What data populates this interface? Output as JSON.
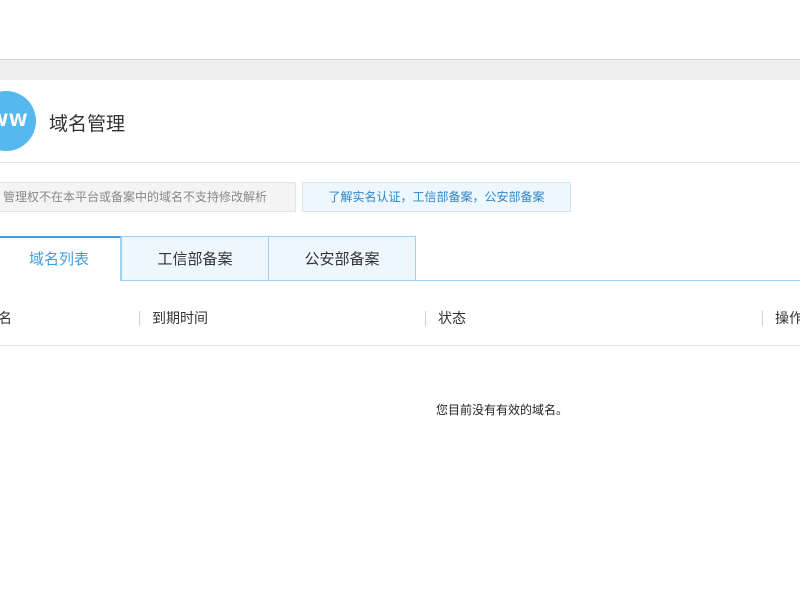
{
  "header": {
    "logo_text": "WW",
    "title": "域名管理"
  },
  "notice": {
    "text": "管理权不在本平台或备案中的域名不支持修改解析",
    "link": "了解实名认证，工信部备案，公安部备案"
  },
  "tabs": [
    {
      "label": "域名列表",
      "active": true
    },
    {
      "label": "工信部备案",
      "active": false
    },
    {
      "label": "公安部备案",
      "active": false
    }
  ],
  "table": {
    "columns": [
      "名",
      "到期时间",
      "状态",
      "操作"
    ],
    "rows": [],
    "empty_text": "您目前没有有效的域名。"
  },
  "colors": {
    "accent": "#3e9fe0",
    "logo_bg": "#55b8ee",
    "tab_border": "#9fd0f0",
    "link": "#2f85c8"
  }
}
